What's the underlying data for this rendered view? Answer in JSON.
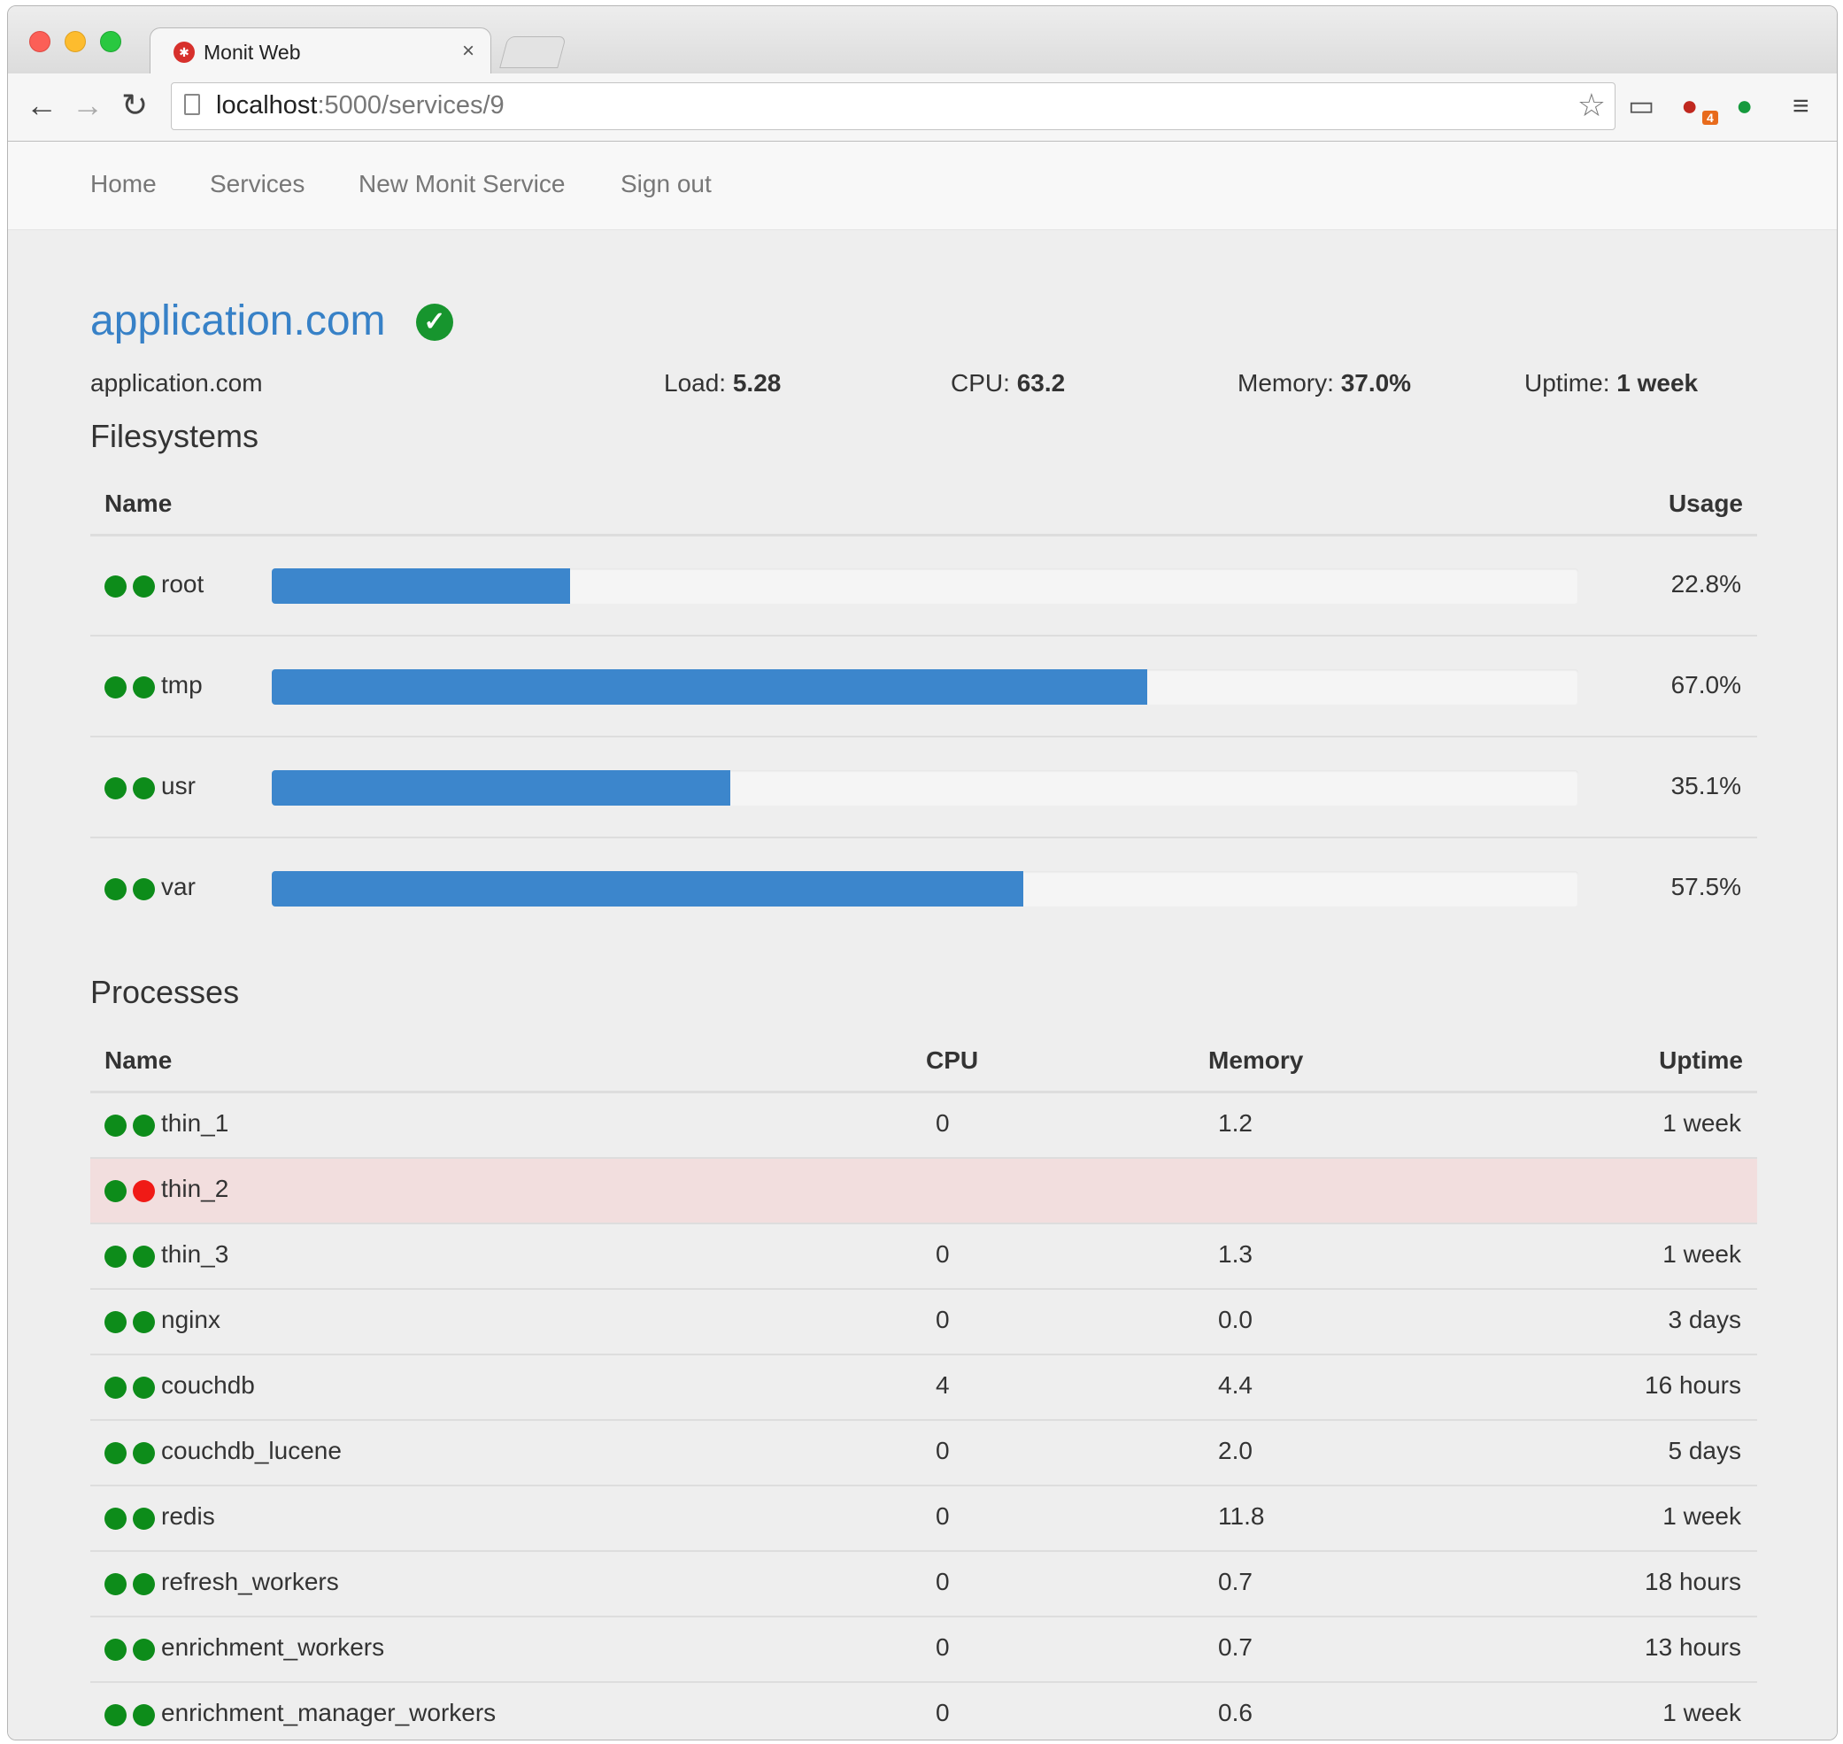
{
  "browser": {
    "tab_title": "Monit Web",
    "tab_close": "×",
    "url_host": "localhost",
    "url_path": ":5000/services/9",
    "extension_badge": "4"
  },
  "nav": [
    "Home",
    "Services",
    "New Monit Service",
    "Sign out"
  ],
  "service": {
    "title": "application.com",
    "status": "ok",
    "hostname": "application.com",
    "load_label": "Load:",
    "load": "5.28",
    "cpu_label": "CPU:",
    "cpu": "63.2",
    "memory_label": "Memory:",
    "memory": "37.0%",
    "uptime_label": "Uptime:",
    "uptime": "1 week"
  },
  "filesystems": {
    "heading": "Filesystems",
    "columns": [
      "Name",
      "Usage"
    ],
    "rows": [
      {
        "name": "root",
        "usage": "22.8%",
        "fraction": 0.228,
        "status": [
          "ok",
          "ok"
        ]
      },
      {
        "name": "tmp",
        "usage": "67.0%",
        "fraction": 0.67,
        "status": [
          "ok",
          "ok"
        ]
      },
      {
        "name": "usr",
        "usage": "35.1%",
        "fraction": 0.351,
        "status": [
          "ok",
          "ok"
        ]
      },
      {
        "name": "var",
        "usage": "57.5%",
        "fraction": 0.575,
        "status": [
          "ok",
          "ok"
        ]
      }
    ]
  },
  "processes": {
    "heading": "Processes",
    "columns": [
      "Name",
      "CPU",
      "Memory",
      "Uptime"
    ],
    "rows": [
      {
        "name": "thin_1",
        "cpu": "0",
        "memory": "1.2",
        "uptime": "1 week",
        "status": [
          "ok",
          "ok"
        ]
      },
      {
        "name": "thin_2",
        "cpu": "",
        "memory": "",
        "uptime": "",
        "status": [
          "ok",
          "fail"
        ],
        "danger": true
      },
      {
        "name": "thin_3",
        "cpu": "0",
        "memory": "1.3",
        "uptime": "1 week",
        "status": [
          "ok",
          "ok"
        ]
      },
      {
        "name": "nginx",
        "cpu": "0",
        "memory": "0.0",
        "uptime": "3 days",
        "status": [
          "ok",
          "ok"
        ]
      },
      {
        "name": "couchdb",
        "cpu": "4",
        "memory": "4.4",
        "uptime": "16 hours",
        "status": [
          "ok",
          "ok"
        ]
      },
      {
        "name": "couchdb_lucene",
        "cpu": "0",
        "memory": "2.0",
        "uptime": "5 days",
        "status": [
          "ok",
          "ok"
        ]
      },
      {
        "name": "redis",
        "cpu": "0",
        "memory": "11.8",
        "uptime": "1 week",
        "status": [
          "ok",
          "ok"
        ]
      },
      {
        "name": "refresh_workers",
        "cpu": "0",
        "memory": "0.7",
        "uptime": "18 hours",
        "status": [
          "ok",
          "ok"
        ]
      },
      {
        "name": "enrichment_workers",
        "cpu": "0",
        "memory": "0.7",
        "uptime": "13 hours",
        "status": [
          "ok",
          "ok"
        ]
      },
      {
        "name": "enrichment_manager_workers",
        "cpu": "0",
        "memory": "0.6",
        "uptime": "1 week",
        "status": [
          "ok",
          "ok"
        ]
      }
    ]
  },
  "colors": {
    "ok": "#0d8c1a",
    "fail": "#f01a16",
    "accent": "#3781c7",
    "bar": "#3c86cc",
    "danger_row": "#f2dede"
  }
}
